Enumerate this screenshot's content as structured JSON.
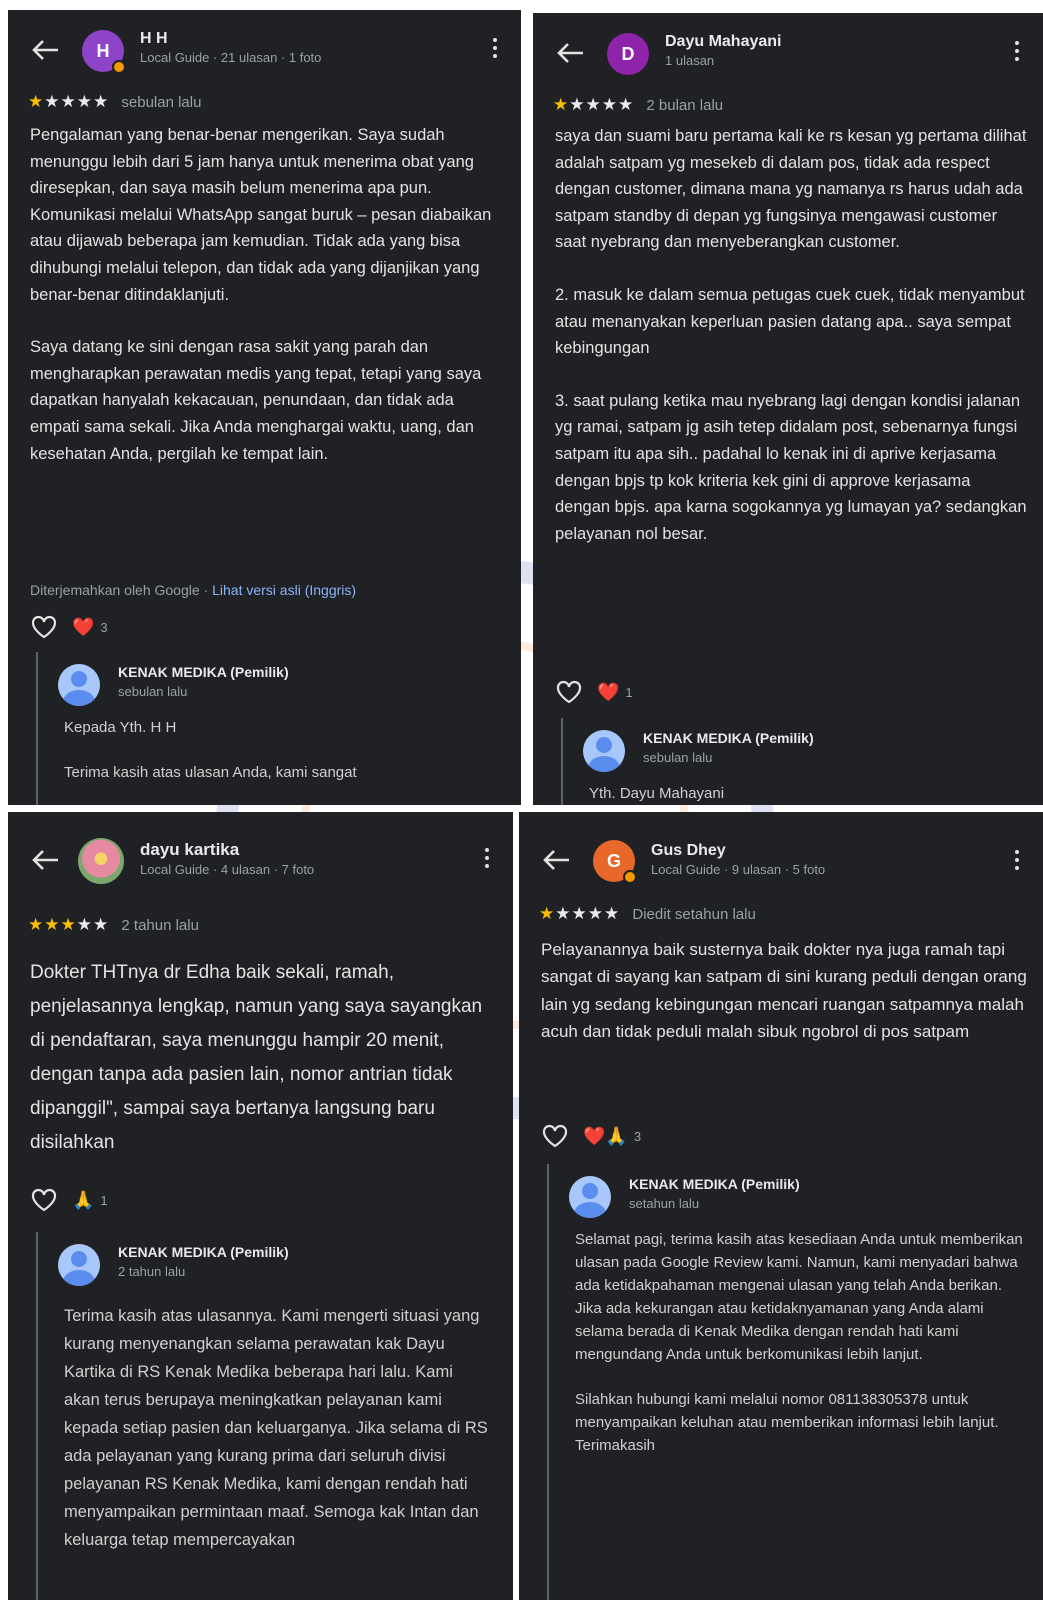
{
  "reviews": [
    {
      "name": "H H",
      "initial": "H",
      "avatar_color": "#8e44c9",
      "meta": "Local Guide · 21 ulasan · 1 foto",
      "stars": 1,
      "time": "sebulan lalu",
      "body": [
        "Pengalaman yang benar-benar mengerikan. Saya sudah menunggu lebih dari 5 jam hanya untuk menerima obat yang diresepkan, dan saya masih belum menerima apa pun. Komunikasi melalui WhatsApp sangat buruk – pesan diabaikan atau dijawab beberapa jam kemudian. Tidak ada yang bisa dihubungi melalui telepon, dan tidak ada yang dijanjikan yang benar-benar ditindaklanjuti.",
        "Saya datang ke sini dengan rasa sakit yang parah dan mengharapkan perawatan medis yang tepat, tetapi yang saya dapatkan hanyalah kekacauan, penundaan, dan tidak ada empati sama sekali. Jika Anda menghargai waktu, uang, dan kesehatan Anda, pergilah ke tempat lain."
      ],
      "translated_label": "Diterjemahkan oleh Google · ",
      "translated_link": "Lihat versi asli (Inggris)",
      "reaction_emoji": "❤️",
      "reaction_count": "3",
      "owner": {
        "name": "KENAK MEDIKA (Pemilik)",
        "time": "sebulan lalu",
        "text": [
          "Kepada Yth. H H",
          "Terima kasih atas ulasan Anda, kami sangat"
        ]
      }
    },
    {
      "name": "Dayu Mahayani",
      "initial": "D",
      "avatar_color": "#8e24aa",
      "meta": "1 ulasan",
      "stars": 1,
      "time": "2 bulan lalu",
      "body": [
        "saya dan suami baru pertama kali ke rs kesan yg pertama dilihat adalah satpam yg mesekeb di dalam pos, tidak ada respect dengan customer, dimana mana yg namanya rs harus udah ada satpam standby di depan yg fungsinya mengawasi customer saat nyebrang dan menyeberangkan customer.",
        "2. masuk ke dalam semua petugas cuek cuek, tidak menyambut atau menanyakan keperluan pasien datang apa.. saya sempat kebingungan",
        "3. saat pulang ketika mau nyebrang lagi dengan kondisi jalanan yg ramai, satpam jg asih tetep didalam post, sebenarnya fungsi satpam itu apa sih.. padahal lo kenak ini di aprive kerjasama dengan bpjs tp kok kriteria kek gini di approve kerjasama dengan bpjs. apa karna sogokannya yg lumayan ya? sedangkan pelayanan nol besar."
      ],
      "reaction_emoji": "❤️",
      "reaction_count": "1",
      "owner": {
        "name": "KENAK MEDIKA (Pemilik)",
        "time": "sebulan lalu",
        "text": [
          "Yth. Dayu Mahayani"
        ]
      }
    },
    {
      "name": "dayu kartika",
      "initial": "",
      "avatar_color": "#d98a9c",
      "meta": "Local Guide · 4 ulasan · 7 foto",
      "stars": 3,
      "time": "2 tahun lalu",
      "body": [
        "Dokter THTnya dr Edha baik sekali, ramah, penjelasannya lengkap, namun yang saya sayangkan di pendaftaran, saya menunggu hampir 20 menit, dengan tanpa ada pasien lain, nomor antrian tidak dipanggil\", sampai saya bertanya langsung baru disilahkan"
      ],
      "reaction_emoji": "🙏",
      "reaction_count": "1",
      "owner": {
        "name": "KENAK MEDIKA (Pemilik)",
        "time": "2 tahun lalu",
        "text": [
          "Terima kasih atas ulasannya. Kami mengerti situasi yang kurang menyenangkan selama perawatan kak Dayu Kartika di RS Kenak Medika beberapa hari lalu. Kami akan terus berupaya meningkatkan pelayanan kami kepada setiap pasien dan keluarganya. Jika selama di RS ada pelayanan yang kurang prima dari seluruh divisi pelayanan RS Kenak Medika, kami dengan rendah hati menyampaikan permintaan maaf. Semoga kak Intan dan keluarga tetap mempercayakan"
        ]
      }
    },
    {
      "name": "Gus Dhey",
      "initial": "G",
      "avatar_color": "#e8672a",
      "meta": "Local Guide · 9 ulasan · 5 foto",
      "stars": 1,
      "time": "Diedit setahun lalu",
      "body": [
        "Pelayanannya baik susternya baik dokter nya juga ramah tapi sangat di sayang kan satpam di sini kurang peduli dengan orang lain yg sedang kebingungan mencari ruangan satpamnya malah acuh dan tidak peduli malah sibuk ngobrol di pos satpam"
      ],
      "reaction_emoji": "❤️🙏",
      "reaction_count": "3",
      "owner": {
        "name": "KENAK MEDIKA (Pemilik)",
        "time": "setahun lalu",
        "text": [
          "Selamat pagi, terima kasih atas kesediaan Anda untuk memberikan ulasan pada Google Review kami. Namun, kami menyadari bahwa ada ketidakpahaman mengenai ulasan yang telah Anda berikan. Jika ada kekurangan atau ketidaknyamanan yang Anda alami selama berada di Kenak Medika dengan rendah hati kami mengundang Anda untuk berkomunikasi lebih lanjut.",
          "Silahkan hubungi kami melalui nomor 081138305378 untuk menyampaikan keluhan atau memberikan informasi lebih lanjut. Terimakasih"
        ]
      }
    }
  ]
}
